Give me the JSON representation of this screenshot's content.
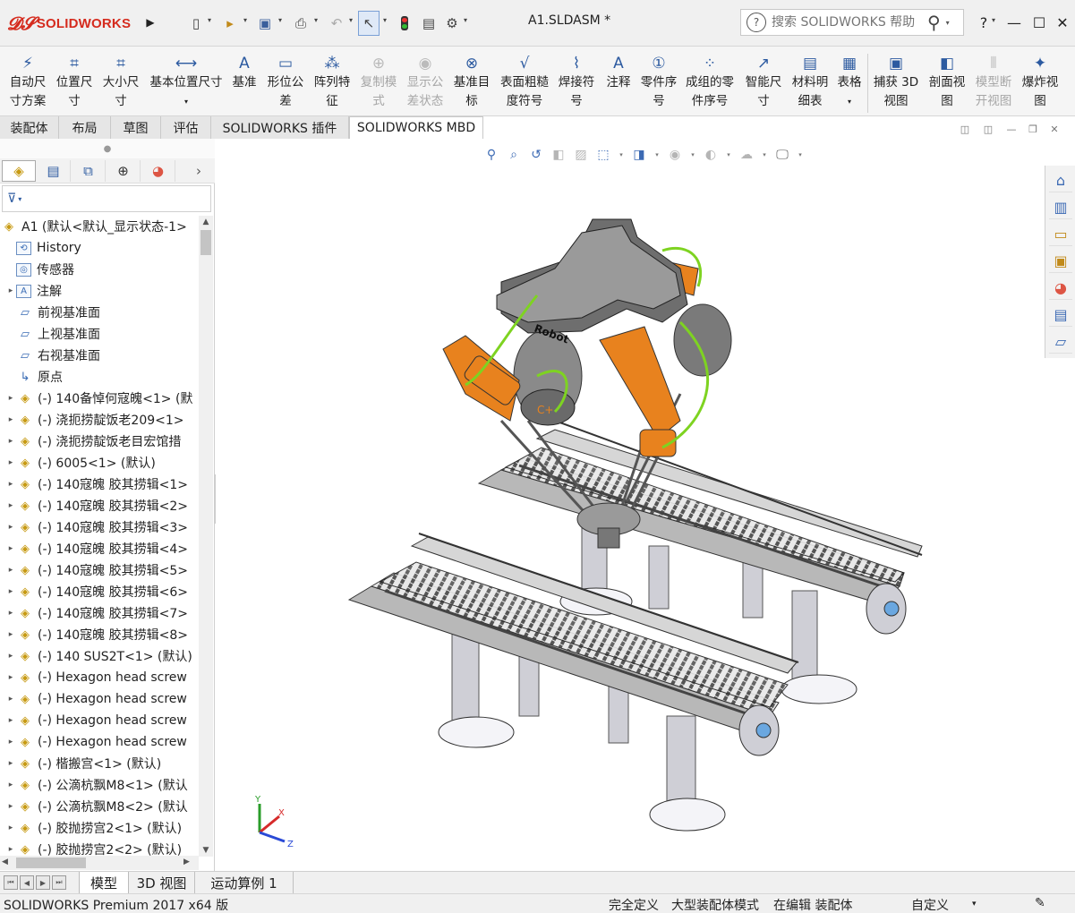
{
  "app": {
    "logo_text": "SOLIDWORKS",
    "document_title": "A1.SLDASM *",
    "search_placeholder": "搜索 SOLIDWORKS 帮助",
    "window_controls": [
      "?",
      "—",
      "☐",
      "✕"
    ]
  },
  "quick_access": [
    "new-icon",
    "open-icon",
    "save-icon",
    "print-icon",
    "undo-icon",
    "select-icon",
    "rebuild-icon",
    "file-properties-icon",
    "options-icon"
  ],
  "command_manager": [
    {
      "id": "auto-dimension",
      "label_l1": "自动尺",
      "label_l2": "寸方案",
      "icon": "⚡",
      "disabled": false
    },
    {
      "id": "location-dimension",
      "label_l1": "位置尺",
      "label_l2": "寸",
      "icon": "⌗",
      "disabled": false
    },
    {
      "id": "size-dimension",
      "label_l1": "大小尺",
      "label_l2": "寸",
      "icon": "⌗",
      "disabled": false
    },
    {
      "id": "basic-location-dimension",
      "label_l1": "基本位置尺寸",
      "label_l2": "▾",
      "icon": "⟷",
      "disabled": false
    },
    {
      "id": "datum",
      "label_l1": "基准",
      "label_l2": "",
      "icon": "A",
      "disabled": false
    },
    {
      "id": "geometric-tolerance",
      "label_l1": "形位公",
      "label_l2": "差",
      "icon": "▭",
      "disabled": false
    },
    {
      "id": "pattern-feature",
      "label_l1": "阵列特",
      "label_l2": "征",
      "icon": "⁂",
      "disabled": false
    },
    {
      "id": "copy-scheme",
      "label_l1": "复制模",
      "label_l2": "式",
      "icon": "⊕",
      "disabled": true
    },
    {
      "id": "show-tolerance-status",
      "label_l1": "显示公",
      "label_l2": "差状态",
      "icon": "◉",
      "disabled": true
    },
    {
      "id": "datum-target",
      "label_l1": "基准目",
      "label_l2": "标",
      "icon": "⊗",
      "disabled": false
    },
    {
      "id": "surface-finish",
      "label_l1": "表面粗糙",
      "label_l2": "度符号",
      "icon": "√",
      "disabled": false
    },
    {
      "id": "weld-symbol",
      "label_l1": "焊接符",
      "label_l2": "号",
      "icon": "⌇",
      "disabled": false
    },
    {
      "id": "note",
      "label_l1": "注释",
      "label_l2": "",
      "icon": "A",
      "disabled": false
    },
    {
      "id": "balloon",
      "label_l1": "零件序",
      "label_l2": "号",
      "icon": "①",
      "disabled": false
    },
    {
      "id": "stacked-balloon",
      "label_l1": "成组的零",
      "label_l2": "件序号",
      "icon": "⁘",
      "disabled": false
    },
    {
      "id": "smart-dimension",
      "label_l1": "智能尺",
      "label_l2": "寸",
      "icon": "↗",
      "disabled": false
    },
    {
      "id": "bill-of-materials",
      "label_l1": "材料明",
      "label_l2": "细表",
      "icon": "▤",
      "disabled": false
    },
    {
      "id": "table",
      "label_l1": "表格",
      "label_l2": "▾",
      "icon": "▦",
      "disabled": false
    },
    {
      "id": "capture-3d-view",
      "label_l1": "捕获 3D",
      "label_l2": "视图",
      "icon": "▣",
      "disabled": false
    },
    {
      "id": "section-view",
      "label_l1": "剖面视",
      "label_l2": "图",
      "icon": "◧",
      "disabled": false
    },
    {
      "id": "model-break-view",
      "label_l1": "模型断",
      "label_l2": "开视图",
      "icon": "⫴",
      "disabled": true
    },
    {
      "id": "exploded-view",
      "label_l1": "爆炸视",
      "label_l2": "图",
      "icon": "✦",
      "disabled": false
    }
  ],
  "tabs": [
    "装配体",
    "布局",
    "草图",
    "评估",
    "SOLIDWORKS 插件",
    "SOLIDWORKS MBD"
  ],
  "active_tab": "SOLIDWORKS MBD",
  "feature_manager": {
    "tabs": [
      "featuremanager-icon",
      "propertymanager-icon",
      "configurationmanager-icon",
      "dimxpert-icon",
      "display-manager-icon"
    ],
    "root": "A1  (默认<默认_显示状态-1>",
    "items": [
      {
        "label": "History",
        "icon": "history-icon",
        "expand": false,
        "kind": "folder"
      },
      {
        "label": "传感器",
        "icon": "sensor-icon",
        "expand": false,
        "kind": "folder"
      },
      {
        "label": "注解",
        "icon": "annotation-icon",
        "expand": true,
        "kind": "folder"
      },
      {
        "label": "前视基准面",
        "icon": "plane-icon",
        "expand": false,
        "kind": "plane"
      },
      {
        "label": "上视基准面",
        "icon": "plane-icon",
        "expand": false,
        "kind": "plane"
      },
      {
        "label": "右视基准面",
        "icon": "plane-icon",
        "expand": false,
        "kind": "plane"
      },
      {
        "label": "原点",
        "icon": "origin-icon",
        "expand": false,
        "kind": "origin"
      },
      {
        "label": "(-) 140备悼何寇魄<1> (默",
        "icon": "part-icon",
        "expand": true,
        "kind": "part"
      },
      {
        "label": "(-) 浇扼捞靛饭老209<1>",
        "icon": "part-icon",
        "expand": true,
        "kind": "part"
      },
      {
        "label": "(-) 浇扼捞靛饭老目宏馆措",
        "icon": "part-icon",
        "expand": true,
        "kind": "part"
      },
      {
        "label": "(-) 6005<1> (默认)",
        "icon": "part-icon",
        "expand": true,
        "kind": "part"
      },
      {
        "label": "(-) 140寇魄 胶其捞辑<1>",
        "icon": "part-icon",
        "expand": true,
        "kind": "part"
      },
      {
        "label": "(-) 140寇魄 胶其捞辑<2>",
        "icon": "part-icon",
        "expand": true,
        "kind": "part"
      },
      {
        "label": "(-) 140寇魄 胶其捞辑<3>",
        "icon": "part-icon",
        "expand": true,
        "kind": "part"
      },
      {
        "label": "(-) 140寇魄 胶其捞辑<4>",
        "icon": "part-icon",
        "expand": true,
        "kind": "part"
      },
      {
        "label": "(-) 140寇魄 胶其捞辑<5>",
        "icon": "part-icon",
        "expand": true,
        "kind": "part"
      },
      {
        "label": "(-) 140寇魄 胶其捞辑<6>",
        "icon": "part-icon",
        "expand": true,
        "kind": "part"
      },
      {
        "label": "(-) 140寇魄 胶其捞辑<7>",
        "icon": "part-icon",
        "expand": true,
        "kind": "part"
      },
      {
        "label": "(-) 140寇魄 胶其捞辑<8>",
        "icon": "part-icon",
        "expand": true,
        "kind": "part"
      },
      {
        "label": "(-) 140 SUS2T<1> (默认)",
        "icon": "part-icon",
        "expand": true,
        "kind": "part"
      },
      {
        "label": "(-) Hexagon head screw",
        "icon": "part-icon",
        "expand": true,
        "kind": "part"
      },
      {
        "label": "(-) Hexagon head screw",
        "icon": "part-icon",
        "expand": true,
        "kind": "part"
      },
      {
        "label": "(-) Hexagon head screw",
        "icon": "part-icon",
        "expand": true,
        "kind": "part"
      },
      {
        "label": "(-) Hexagon head screw",
        "icon": "part-icon",
        "expand": true,
        "kind": "part"
      },
      {
        "label": "(-) 楷搬宫<1> (默认)",
        "icon": "part-icon",
        "expand": true,
        "kind": "part"
      },
      {
        "label": "(-) 公滴杭飘M8<1> (默认",
        "icon": "part-icon",
        "expand": true,
        "kind": "part"
      },
      {
        "label": "(-) 公滴杭飘M8<2> (默认",
        "icon": "part-icon",
        "expand": true,
        "kind": "part"
      },
      {
        "label": "(-) 胶抛捞宫2<1> (默认)",
        "icon": "part-icon",
        "expand": true,
        "kind": "part"
      },
      {
        "label": "(-) 胶抛捞宫2<2> (默认)",
        "icon": "part-icon",
        "expand": true,
        "kind": "part"
      }
    ]
  },
  "viewport": {
    "heads_up_toolbar": [
      "zoom-to-fit-icon",
      "zoom-to-area-icon",
      "previous-view-icon",
      "section-view-icon",
      "dynamic-annotation-icon",
      "view-orientation-icon",
      "display-style-icon",
      "hide-show-items-icon",
      "edit-appearance-icon",
      "apply-scene-icon",
      "view-settings-icon"
    ],
    "robot_label": "Robot",
    "triad": {
      "x": "X",
      "y": "Y",
      "z": "Z"
    }
  },
  "task_pane": [
    "home-icon",
    "design-library-icon",
    "file-explorer-icon",
    "view-palette-icon",
    "appearances-icon",
    "custom-properties-icon",
    "forum-icon"
  ],
  "bottom_tabs": [
    "模型",
    "3D 视图",
    "运动算例 1"
  ],
  "active_bottom_tab": "模型",
  "status_bar": {
    "product": "SOLIDWORKS Premium 2017 x64 版",
    "fully_defined": "完全定义",
    "large_assembly": "大型装配体模式",
    "editing": "在编辑 装配体",
    "units": "自定义"
  },
  "colors": {
    "brand": "#d52b1e",
    "accent": "#2c5aa0",
    "robot_orange": "#e8821e",
    "cable_green": "#7ed321"
  }
}
